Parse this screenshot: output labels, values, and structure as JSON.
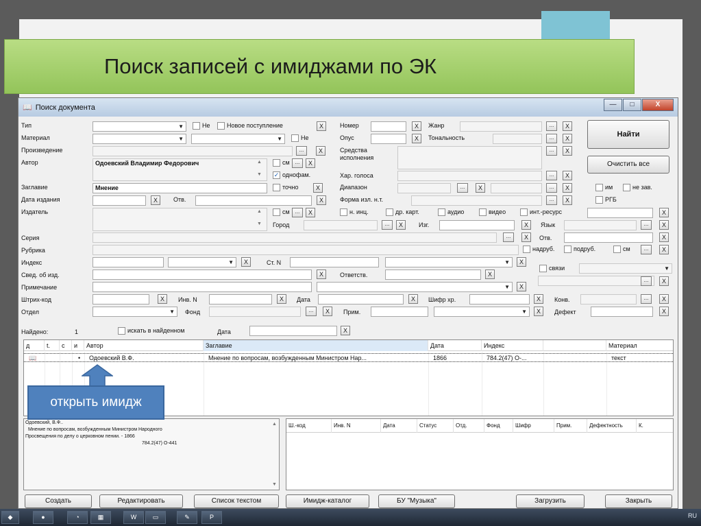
{
  "slide": {
    "title": "Поиск записей с имиджами по ЭК"
  },
  "window": {
    "title": "Поиск документа",
    "minimize": "—",
    "maximize": "□",
    "close": "X"
  },
  "common": {
    "x": "X",
    "ellipsis": "...",
    "check": "✓",
    "arrow_up": "▲",
    "arrow_down": "▼"
  },
  "labels": {
    "type": "Тип",
    "material": "Материал",
    "work": "Произведение",
    "author": "Автор",
    "title": "Заглавие",
    "pub_date": "Дата издания",
    "resp": "Отв.",
    "publisher": "Издатель",
    "city": "Город",
    "izg": "Изг.",
    "series": "Серия",
    "rubric": "Рубрика",
    "index": "Индекс",
    "st_n": "Ст. N",
    "sved": "Свед. об изд.",
    "responsible": "Ответств.",
    "note": "Примечание",
    "barcode": "Штрих-код",
    "inv_n": "Инв. N",
    "date": "Дата",
    "shelf": "Шифр хр.",
    "conv": "Конв.",
    "dept": "Отдел",
    "fond": "Фонд",
    "prim": "Прим.",
    "defect": "Дефект",
    "number": "Номер",
    "opus": "Опус",
    "genre": "Жанр",
    "tonality": "Тональность",
    "means": "Средства исполнения",
    "voice": "Хар. голоса",
    "range": "Диапазон",
    "form": "Форма изл. н.т.",
    "language": "Язык",
    "resp2": "Отв.",
    "found": "Найдено:",
    "found_count": "1",
    "search_found": "искать в найденном",
    "date2": "Дата"
  },
  "checkboxes": {
    "not": "Не",
    "new_arrival": "Новое поступление",
    "not2": "Не",
    "sm": "см",
    "odnofam": "однофам.",
    "exact": "точно",
    "sm2": "см",
    "n_inc": "н. инц.",
    "dr_kart": "др. карт.",
    "audio": "аудио",
    "video": "видео",
    "inet": "инт.-ресурс",
    "im": "им",
    "ne_zav": "не зав.",
    "rgb": "РГБ",
    "nadrub": "надруб.",
    "podrub": "подруб.",
    "sm3": "см",
    "links": "связи"
  },
  "values": {
    "author": "Одоевский Владимир Федорович",
    "title": "Мнение"
  },
  "buttons": {
    "find": "Найти",
    "clear_all": "Очистить все",
    "create": "Создать",
    "edit": "Редактировать",
    "list_text": "Список текстом",
    "image_catalog": "Имидж-каталог",
    "bu_music": "БУ \"Музыка\"",
    "load": "Загрузить",
    "close": "Закрыть"
  },
  "results": {
    "columns": [
      "д",
      "t.",
      "с",
      "и",
      "Автор",
      "Заглавие",
      "Дата",
      "Индекс",
      "",
      "Материал"
    ],
    "rows": [
      {
        "icon": "book-icon",
        "mark": "•",
        "author": "Одоевский В.Ф.",
        "title": "Мнение по вопросам, возбужденным Министром Нар...",
        "date": "1866",
        "index": "784.2(47) О-...",
        "material": "текст"
      }
    ]
  },
  "preview": {
    "line1": "Одоевский, В.Ф..",
    "line2": "Мнение по вопросам, возбужденным Министром Народного",
    "line3": "Просвещения по делу о церковном пении. - 1866",
    "line4": "784.2(47) О-441"
  },
  "copies": {
    "columns": [
      "Ш.-код",
      "Инв. N",
      "Дата",
      "Статус",
      "Отд.",
      "Фонд",
      "Шифр",
      "Прим.",
      "Дефектность",
      "К."
    ]
  },
  "callout": {
    "text": "открыть имидж"
  },
  "taskbar": {
    "lang": "RU"
  },
  "colors": {
    "banner": "#a6d16c",
    "callout": "#4f81bd",
    "teal": "#7fc3d4"
  }
}
